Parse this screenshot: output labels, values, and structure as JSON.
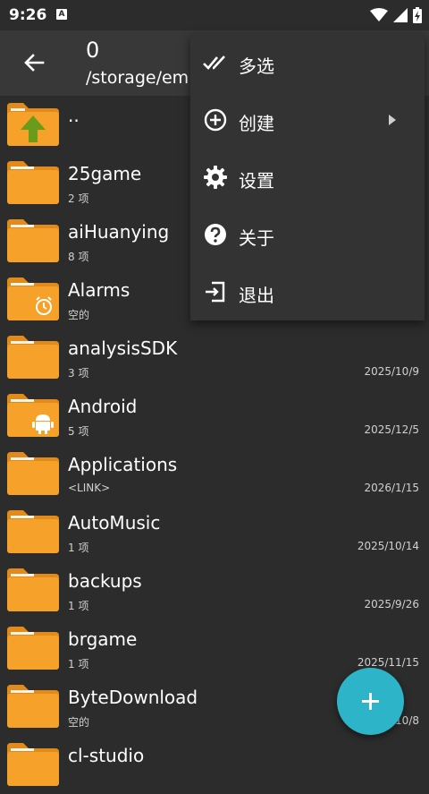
{
  "status": {
    "time": "9:26",
    "badge": "A"
  },
  "appbar": {
    "title": "0",
    "path": "/storage/em"
  },
  "colors": {
    "folder": "#f6a12a",
    "folder_tab": "#e28a1a",
    "accent": "#2eb4c8",
    "up_arrow": "#6b9b1b"
  },
  "files": [
    {
      "name": "..",
      "meta": "",
      "date": "",
      "icon": "folder-up-icon"
    },
    {
      "name": "25game",
      "meta": "2 项",
      "date": "",
      "icon": "folder-icon"
    },
    {
      "name": "aiHuanying",
      "meta": "8 项",
      "date": "",
      "icon": "folder-icon"
    },
    {
      "name": "Alarms",
      "meta": "空的",
      "date": "",
      "icon": "folder-alarm-icon"
    },
    {
      "name": "analysisSDK",
      "meta": "3 项",
      "date": "2025/10/9",
      "icon": "folder-icon"
    },
    {
      "name": "Android",
      "meta": "5 项",
      "date": "2025/12/5",
      "icon": "folder-android-icon"
    },
    {
      "name": "Applications",
      "meta": "<LINK>",
      "date": "2026/1/15",
      "icon": "folder-icon"
    },
    {
      "name": "AutoMusic",
      "meta": "1 项",
      "date": "2025/10/14",
      "icon": "folder-icon"
    },
    {
      "name": "backups",
      "meta": "1 项",
      "date": "2025/9/26",
      "icon": "folder-icon"
    },
    {
      "name": "brgame",
      "meta": "1 项",
      "date": "2025/11/15",
      "icon": "folder-icon"
    },
    {
      "name": "ByteDownload",
      "meta": "空的",
      "date": "2025/10/8",
      "icon": "folder-icon"
    },
    {
      "name": "cl-studio",
      "meta": "",
      "date": "",
      "icon": "folder-icon"
    }
  ],
  "menu": {
    "items": [
      {
        "label": "多选",
        "icon": "double-check-icon"
      },
      {
        "label": "创建",
        "icon": "add-circle-icon"
      },
      {
        "label": "设置",
        "icon": "gear-icon"
      },
      {
        "label": "关于",
        "icon": "help-icon"
      },
      {
        "label": "退出",
        "icon": "exit-icon"
      }
    ]
  },
  "fab": {
    "icon": "plus-icon"
  }
}
